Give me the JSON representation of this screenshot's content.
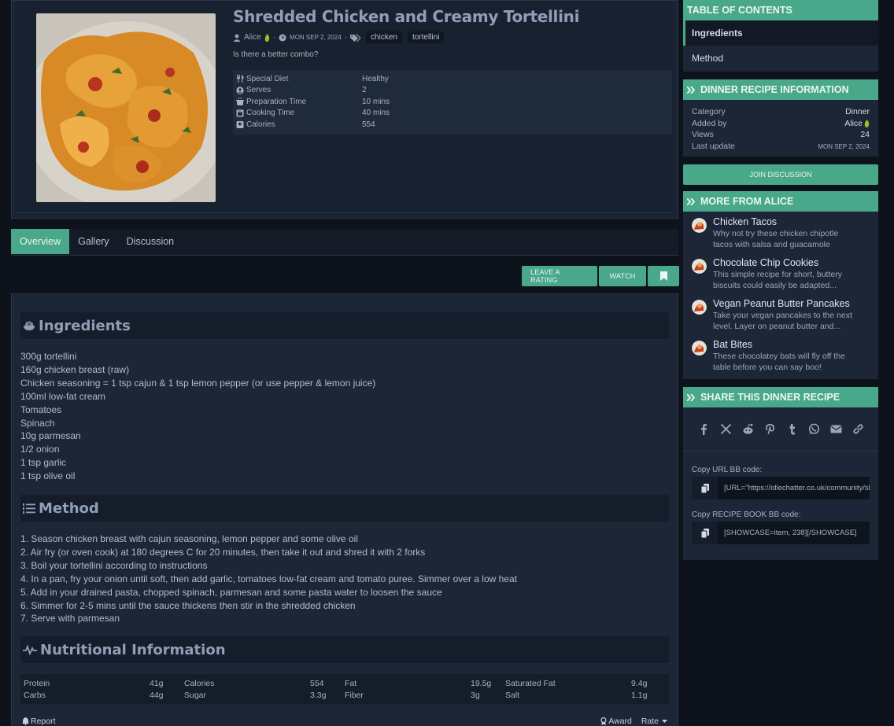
{
  "recipe": {
    "title": "Shredded Chicken and Creamy Tortellini",
    "author": "Alice",
    "date": "MON SEP 2, 2024",
    "tags": [
      "chicken",
      "tortellini"
    ],
    "tagline": "Is there a better combo?",
    "info": [
      {
        "label": "Special Diet",
        "value": "Healthy",
        "icon": "utensils-icon"
      },
      {
        "label": "Serves",
        "value": "2",
        "icon": "user-icon"
      },
      {
        "label": "Preparation Time",
        "value": "10 mins",
        "icon": "cooking-pot-icon"
      },
      {
        "label": "Cooking Time",
        "value": "40 mins",
        "icon": "oven-icon"
      },
      {
        "label": "Calories",
        "value": "554",
        "icon": "scale-icon"
      }
    ]
  },
  "tabs": [
    "Overview",
    "Gallery",
    "Discussion"
  ],
  "actions": {
    "rate": "LEAVE A RATING",
    "watch": "WATCH"
  },
  "ingredients": {
    "heading": "Ingredients",
    "items": [
      "300g tortellini",
      "160g chicken breast (raw)",
      "Chicken seasoning = 1 tsp cajun & 1 tsp lemon pepper (or use pepper & lemon juice)",
      "100ml low-fat cream",
      "Tomatoes",
      "Spinach",
      "10g parmesan",
      "1/2 onion",
      "1 tsp garlic",
      "1 tsp olive oil"
    ]
  },
  "method": {
    "heading": "Method",
    "steps": [
      "1. Season chicken breast with cajun seasoning, lemon pepper and some olive oil",
      "2. Air fry (or oven cook) at 180 degrees C for 20 minutes, then take it out and shred it with 2 forks",
      "3. Boil your tortellini according to instructions",
      "4. In a pan, fry your onion until soft, then add garlic, tomatoes low-fat cream and tomato puree. Simmer over a low heat",
      "5. Add in your drained pasta, chopped spinach, parmesan and some pasta water to loosen the sauce",
      "6. Simmer for 2-5 mins until the sauce thickens then stir in the shredded chicken",
      "7. Serve with parmesan"
    ]
  },
  "nutrition": {
    "heading": "Nutritional Information",
    "rows": [
      [
        {
          "label": "Protein",
          "value": "41g"
        },
        {
          "label": "Calories",
          "value": "554"
        },
        {
          "label": "Fat",
          "value": "19.5g"
        },
        {
          "label": "Saturated Fat",
          "value": "9.4g"
        }
      ],
      [
        {
          "label": "Carbs",
          "value": "44g"
        },
        {
          "label": "Sugar",
          "value": "3.3g"
        },
        {
          "label": "Fiber",
          "value": "3g"
        },
        {
          "label": "Salt",
          "value": "1.1g"
        }
      ]
    ]
  },
  "footer": {
    "report": "Report",
    "award": "Award",
    "rate": "Rate"
  },
  "sidebar": {
    "toc": {
      "title": "TABLE OF CONTENTS",
      "items": [
        "Ingredients",
        "Method"
      ]
    },
    "info": {
      "title": "DINNER RECIPE INFORMATION",
      "rows": [
        {
          "label": "Category",
          "value": "Dinner"
        },
        {
          "label": "Added by",
          "value": "Alice"
        },
        {
          "label": "Views",
          "value": "24"
        },
        {
          "label": "Last update",
          "value": "MON SEP 2, 2024"
        }
      ]
    },
    "join": "JOIN DISCUSSION",
    "more": {
      "title": "MORE FROM ALICE",
      "items": [
        {
          "title": "Chicken Tacos",
          "desc1": "Why not try these chicken chipotle",
          "desc2": "tacos with salsa and guacamole"
        },
        {
          "title": "Chocolate Chip Cookies",
          "desc1": "This simple recipe for short, buttery",
          "desc2": "biscuits could easily be adapted..."
        },
        {
          "title": "Vegan Peanut Butter Pancakes",
          "desc1": "Take your vegan pancakes to the next",
          "desc2": "level. Layer on peanut butter and..."
        },
        {
          "title": "Bat Bites",
          "desc1": "These chocolatey bats will fly off the",
          "desc2": "table before you can say boo!"
        }
      ]
    },
    "share": {
      "title": "SHARE THIS DINNER RECIPE",
      "icons": [
        "facebook-icon",
        "x-icon",
        "reddit-icon",
        "pinterest-icon",
        "tumblr-icon",
        "whatsapp-icon",
        "email-icon",
        "link-icon"
      ],
      "url_label": "Copy URL BB code:",
      "url_value": "[URL=\"https://idlechatter.co.uk/community/showcase/shredded-chicken-and-creamy-tortellini.238/\"]Shredded Chicken and Creamy Tortellini[/URL]",
      "book_label": "Copy RECIPE BOOK BB code:",
      "book_value": "[SHOWCASE=item, 238][/SHOWCASE]"
    }
  },
  "colors": {
    "accent": "#4aa88a",
    "panel": "#1c2637",
    "background": "#0e131b"
  }
}
